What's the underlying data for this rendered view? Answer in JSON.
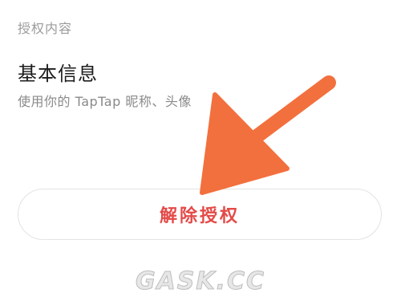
{
  "auth": {
    "section_label": "授权内容",
    "info_title": "基本信息",
    "info_description": "使用你的 TapTap 昵称、头像",
    "revoke_label": "解除授权"
  },
  "overlay": {
    "arrow_color": "#f2703e",
    "watermark_text": "GASK.CC"
  },
  "colors": {
    "accent_red": "#e34a48",
    "muted_text": "#9b9b9b",
    "primary_text": "#1c1c1c"
  }
}
